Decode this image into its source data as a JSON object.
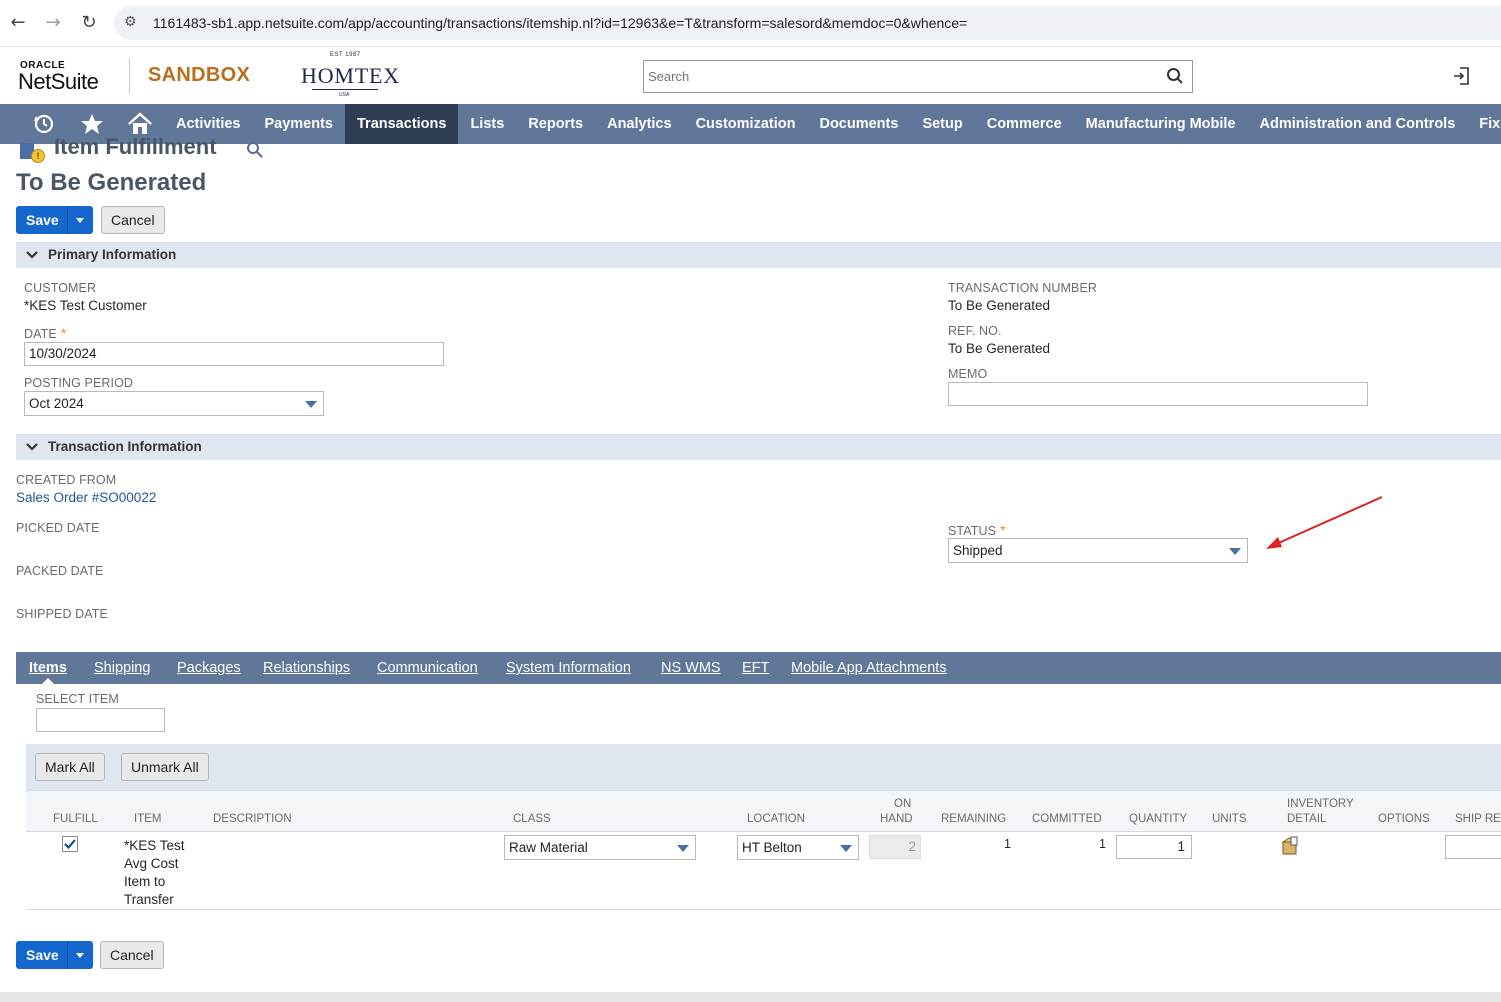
{
  "browser": {
    "url": "1161483-sb1.app.netsuite.com/app/accounting/transactions/itemship.nl?id=12963&e=T&transform=salesord&memdoc=0&whence="
  },
  "header": {
    "oracle": "ORACLE",
    "netsuite": "NetSuite",
    "sandbox": "SANDBOX",
    "homtex_est": "EST 1987",
    "homtex": "HOMTEX",
    "homtex_usa": "USA",
    "search_placeholder": "Search"
  },
  "nav": {
    "items": [
      "Activities",
      "Payments",
      "Transactions",
      "Lists",
      "Reports",
      "Analytics",
      "Customization",
      "Documents",
      "Setup",
      "Commerce",
      "Manufacturing Mobile",
      "Administration and Controls",
      "Fixed A"
    ],
    "active": "Transactions"
  },
  "page": {
    "record_type": "Item Fulfillment",
    "title": "To Be Generated",
    "badge": "!"
  },
  "buttons": {
    "save": "Save",
    "cancel": "Cancel",
    "mark_all": "Mark All",
    "unmark_all": "Unmark All"
  },
  "primary": {
    "section": "Primary Information",
    "customer_label": "Customer",
    "customer_value": "*KES Test Customer",
    "date_label": "Date",
    "date_value": "10/30/2024",
    "posting_period_label": "Posting Period",
    "posting_period_value": "Oct 2024",
    "transaction_number_label": "Transaction Number",
    "transaction_number_value": "To Be Generated",
    "ref_no_label": "Ref. No.",
    "ref_no_value": "To Be Generated",
    "memo_label": "Memo",
    "memo_value": "",
    "required_mark": "*"
  },
  "transaction": {
    "section": "Transaction Information",
    "created_from_label": "Created From",
    "created_from_value": "Sales Order #SO00022",
    "picked_date_label": "Picked Date",
    "packed_date_label": "Packed Date",
    "shipped_date_label": "Shipped Date",
    "status_label": "Status",
    "status_value": "Shipped"
  },
  "subtabs": [
    "Items",
    "Shipping",
    "Packages",
    "Relationships",
    "Communication",
    "System Information",
    "NS WMS",
    "EFT",
    "Mobile App Attachments"
  ],
  "items": {
    "select_item_label": "Select Item",
    "columns": {
      "fulfill": "Fulfill",
      "item": "Item",
      "description": "Description",
      "class": "Class",
      "location": "Location",
      "on_hand_1": "On",
      "on_hand_2": "Hand",
      "remaining": "Remaining",
      "committed": "Committed",
      "quantity": "Quantity",
      "units": "Units",
      "inventory_1": "Inventory",
      "inventory_2": "Detail",
      "options": "Options",
      "ship_rea": "Ship Rea"
    },
    "row": {
      "fulfill": true,
      "item_lines": [
        "*KES Test",
        "Avg Cost",
        "Item to",
        "Transfer"
      ],
      "class": "Raw Material",
      "location": "HT Belton",
      "on_hand": "2",
      "remaining": "1",
      "committed": "1",
      "quantity": "1"
    }
  },
  "colors": {
    "nav_bg": "#607799",
    "nav_active": "#2e3d54",
    "primary_button": "#1467cc",
    "section_bg": "#e0e6ef",
    "sandbox": "#b96e1b",
    "annotation_arrow": "#e02020"
  }
}
